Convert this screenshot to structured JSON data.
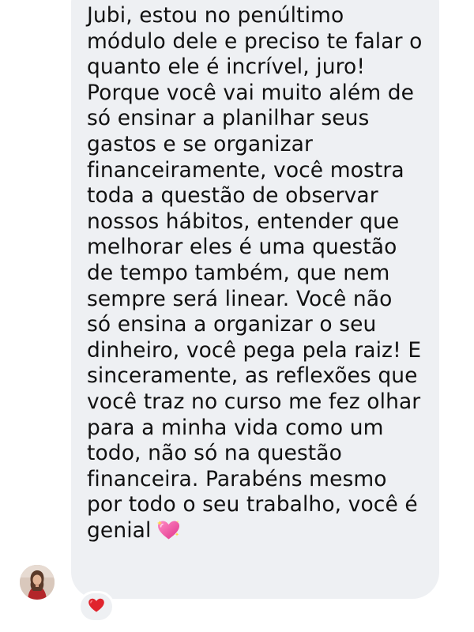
{
  "message": {
    "lines": [
      "Jubi, estou no penúltimo",
      "módulo dele e preciso te falar o",
      "quanto ele é incrível, juro!",
      "Porque você vai muito além de",
      "só ensinar a planilhar seus",
      "gastos e se organizar",
      "financeiramente, você mostra",
      "toda a questão de observar",
      "nossos hábitos, entender que",
      "melhorar eles é uma questão",
      "de tempo também, que nem",
      "sempre será linear. Você não",
      "só ensina a organizar o seu",
      "dinheiro, você pega pela raiz! E",
      "sinceramente, as reflexões que",
      "você traz no curso me fez olhar",
      "para a minha vida como um",
      "todo, não só na questão",
      "financeira. Parabéns mesmo",
      "por todo o seu trabalho, você é",
      "genial"
    ],
    "trailing_emoji": "sparkling-heart-icon"
  },
  "reaction": {
    "emoji": "red-heart-icon"
  },
  "colors": {
    "bubble_background": "#eef0f3",
    "text": "#111111",
    "heart_red": "#e0242d",
    "sparkling_heart_pink": "#f25ca2"
  }
}
